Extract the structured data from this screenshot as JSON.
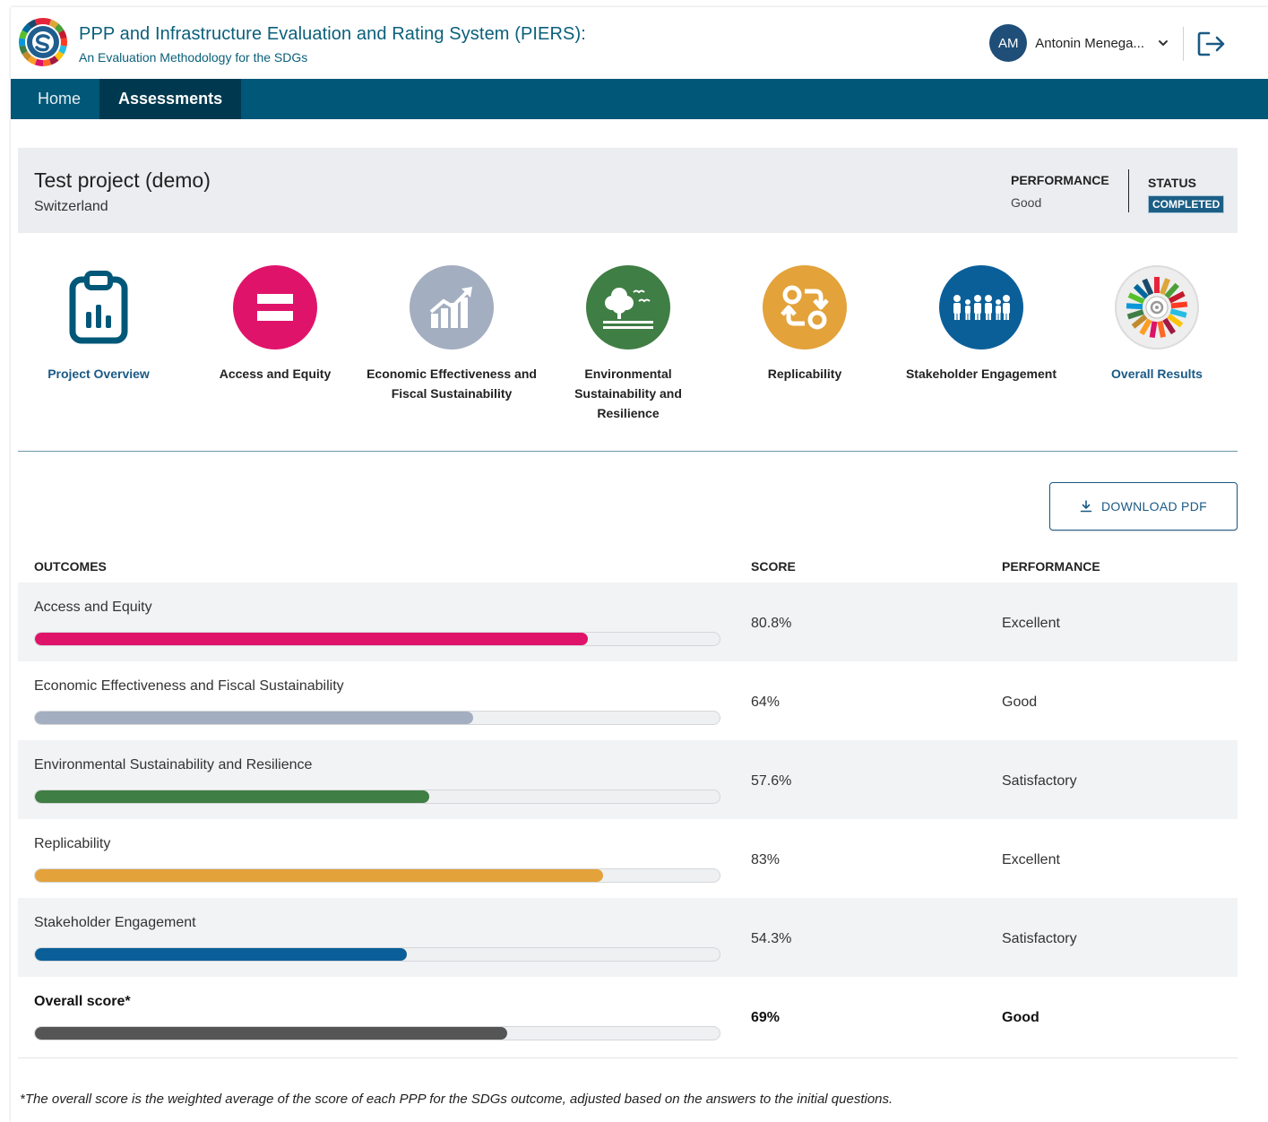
{
  "header": {
    "title": "PPP and Infrastructure Evaluation and Rating System (PIERS):",
    "subtitle": "An Evaluation Methodology for the SDGs",
    "user_initials": "AM",
    "user_name": "Antonin Menega...",
    "icons": {
      "logo": "piers-logo-icon",
      "chevron": "chevron-down-icon",
      "logout": "logout-icon"
    }
  },
  "nav": {
    "items": [
      {
        "label": "Home",
        "active": false
      },
      {
        "label": "Assessments",
        "active": true
      }
    ]
  },
  "project": {
    "name": "Test project (demo)",
    "country": "Switzerland",
    "performance_label": "PERFORMANCE",
    "performance_value": "Good",
    "status_label": "STATUS",
    "status_value": "COMPLETED"
  },
  "categories": [
    {
      "label": "Project Overview",
      "icon": "clipboard-chart-icon",
      "color": "#005778"
    },
    {
      "label": "Access and Equity",
      "icon": "equal-sign-icon",
      "color": "#e0136b"
    },
    {
      "label": "Economic Effectiveness and Fiscal Sustainability",
      "icon": "growth-chart-icon",
      "color": "#a3aec0"
    },
    {
      "label": "Environmental Sustainability and Resilience",
      "icon": "tree-birds-icon",
      "color": "#3f7e44"
    },
    {
      "label": "Replicability",
      "icon": "replicate-arrows-icon",
      "color": "#e3a23a"
    },
    {
      "label": "Stakeholder Engagement",
      "icon": "people-group-icon",
      "color": "#0a5f99"
    },
    {
      "label": "Overall Results",
      "icon": "sdg-wheel-icon",
      "color": "#f0f0f0"
    }
  ],
  "actions": {
    "download_label": "DOWNLOAD PDF"
  },
  "table": {
    "headers": {
      "outcomes": "OUTCOMES",
      "score": "SCORE",
      "performance": "PERFORMANCE"
    },
    "rows": [
      {
        "name": "Access and Equity",
        "score": "80.8%",
        "fraction": 0.808,
        "performance": "Excellent",
        "color": "#e0136b"
      },
      {
        "name": "Economic Effectiveness and Fiscal Sustainability",
        "score": "64%",
        "fraction": 0.64,
        "performance": "Good",
        "color": "#a3aec0"
      },
      {
        "name": "Environmental Sustainability and Resilience",
        "score": "57.6%",
        "fraction": 0.576,
        "performance": "Satisfactory",
        "color": "#3f7e44"
      },
      {
        "name": "Replicability",
        "score": "83%",
        "fraction": 0.83,
        "performance": "Excellent",
        "color": "#e3a23a"
      },
      {
        "name": "Stakeholder Engagement",
        "score": "54.3%",
        "fraction": 0.543,
        "performance": "Satisfactory",
        "color": "#0a5f99"
      }
    ],
    "total": {
      "name": "Overall score*",
      "score": "69%",
      "fraction": 0.69,
      "performance": "Good",
      "color": "#555555"
    }
  },
  "footnote": "*The overall score is the weighted average of the score of each PPP for the SDGs outcome, adjusted based on the answers to the initial questions."
}
